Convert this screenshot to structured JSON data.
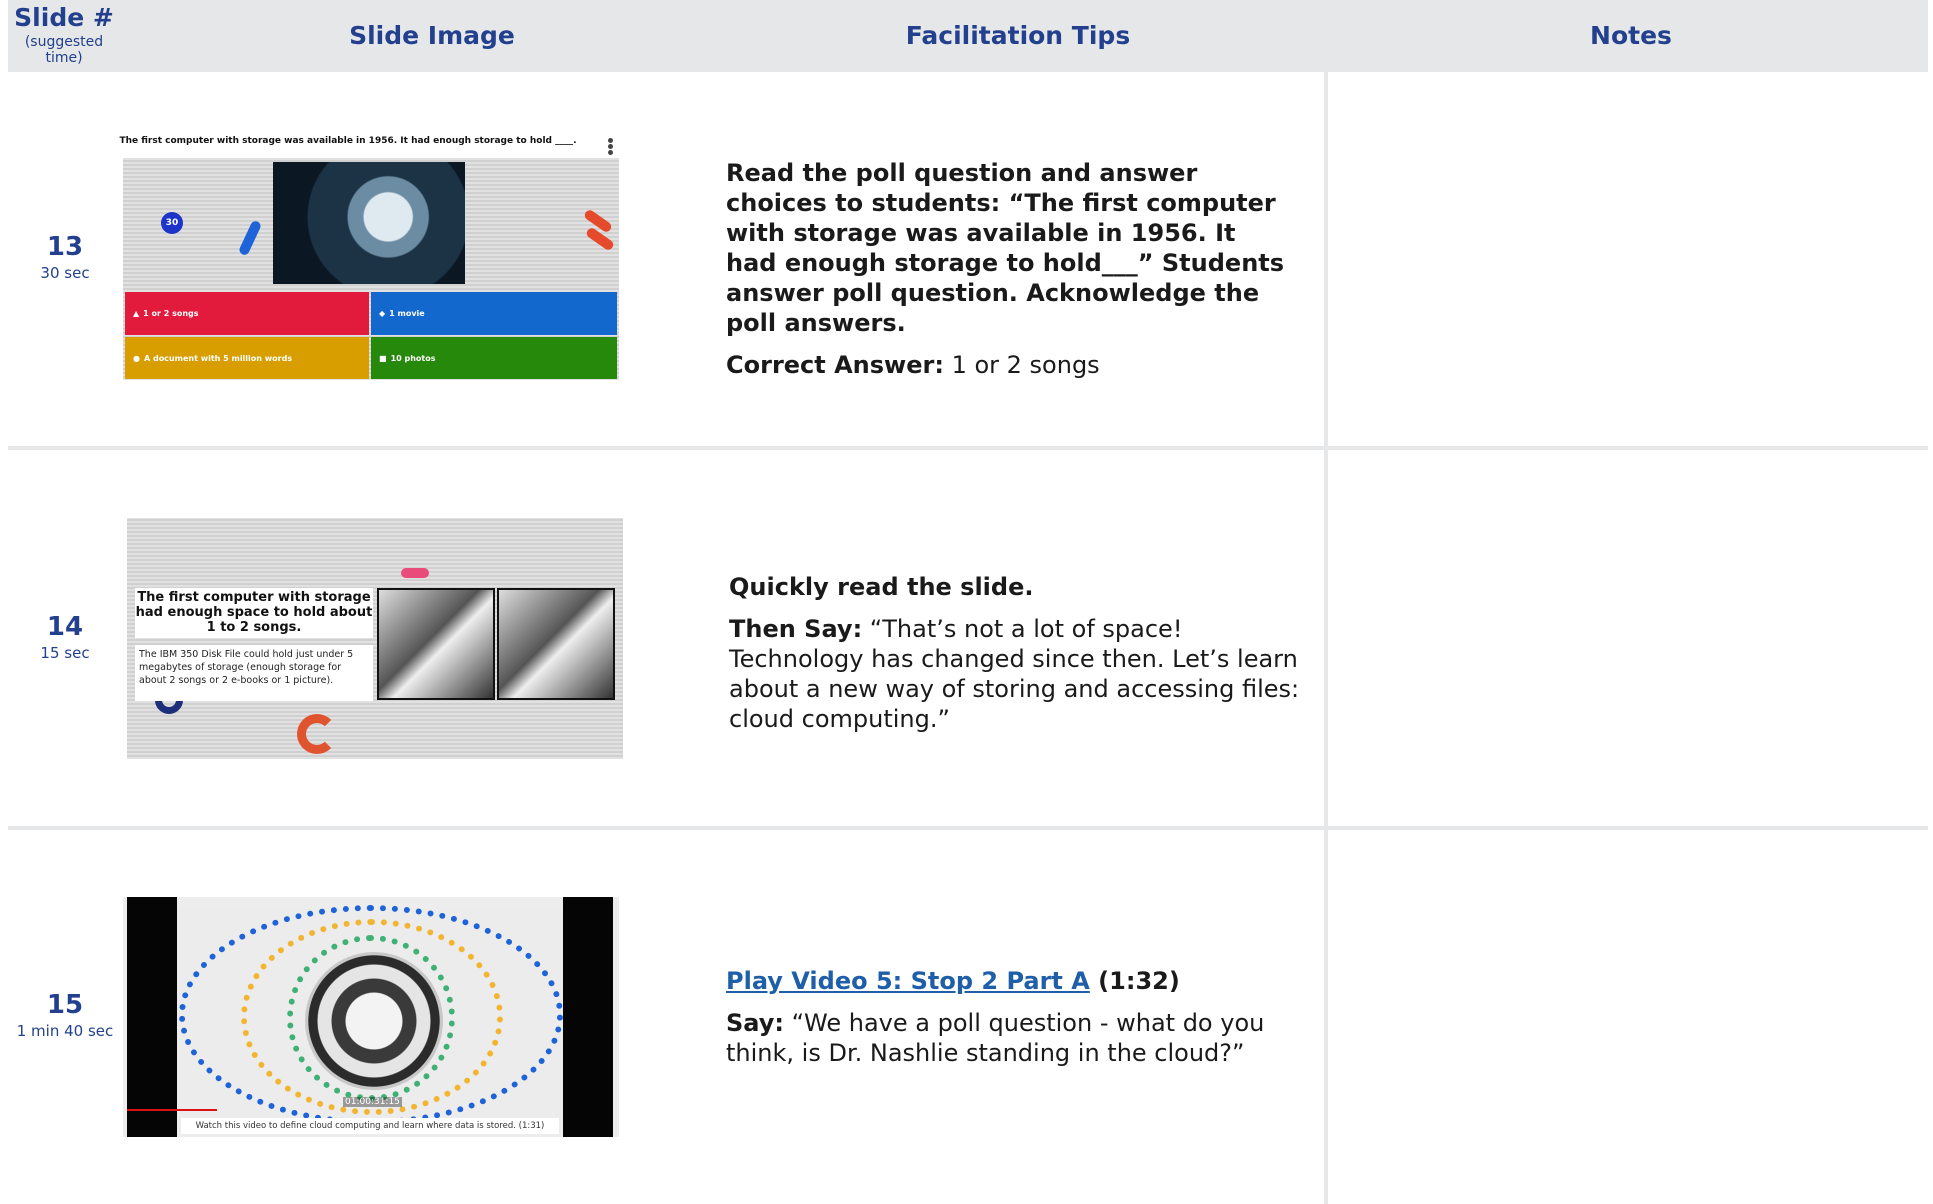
{
  "header": {
    "slide_col": "Slide #",
    "slide_sub": "(suggested time)",
    "image_col": "Slide Image",
    "tips_col": "Facilitation Tips",
    "notes_col": "Notes"
  },
  "rows": [
    {
      "number": "13",
      "time": "30 sec",
      "slide": {
        "question": "The first computer with storage was available in 1956. It had enough storage to hold ____.",
        "timer": "30",
        "answers": [
          "1 or 2 songs",
          "1 movie",
          "A document with 5 million words",
          "10 photos"
        ],
        "answer_colors": [
          "#e21b3c",
          "#1368ce",
          "#d89e00",
          "#26890c"
        ]
      },
      "tips": {
        "p1": "Read the poll question and answer choices to students: “The first computer with storage was available in 1956. It had enough storage to hold___” Students answer poll question. Acknowledge the poll answers.",
        "p2_label": "Correct Answer:",
        "p2_text": " 1 or 2 songs"
      }
    },
    {
      "number": "14",
      "time": "15 sec",
      "slide": {
        "title": "The first computer with storage had enough space to hold about 1 to 2 songs.",
        "desc": "The IBM 350 Disk File could hold just under 5 megabytes of storage (enough storage for about 2 songs or 2 e-books or 1 picture)."
      },
      "tips": {
        "p1": "Quickly read the slide.",
        "p2_label": "Then Say:",
        "p2_text": " “That’s not a lot of space! Technology has changed since then. Let’s learn about a new way of storing and accessing files: cloud computing.”"
      }
    },
    {
      "number": "15",
      "time": "1 min 40 sec",
      "slide": {
        "timestamp": "01:00:31:15",
        "caption": "Watch this video to define cloud computing and learn where data is stored. (1:31)"
      },
      "tips": {
        "link": "Play Video 5: Stop 2 Part A",
        "link_suffix": " (1:32)",
        "p2_label": "Say:",
        "p2_text": " “We have a poll question - what do you think, is Dr. Nashlie standing in the cloud?”"
      }
    }
  ],
  "colors": {
    "header_bg": "#e6e7e9",
    "accent_blue": "#23408e",
    "link": "#1f5ea8"
  }
}
